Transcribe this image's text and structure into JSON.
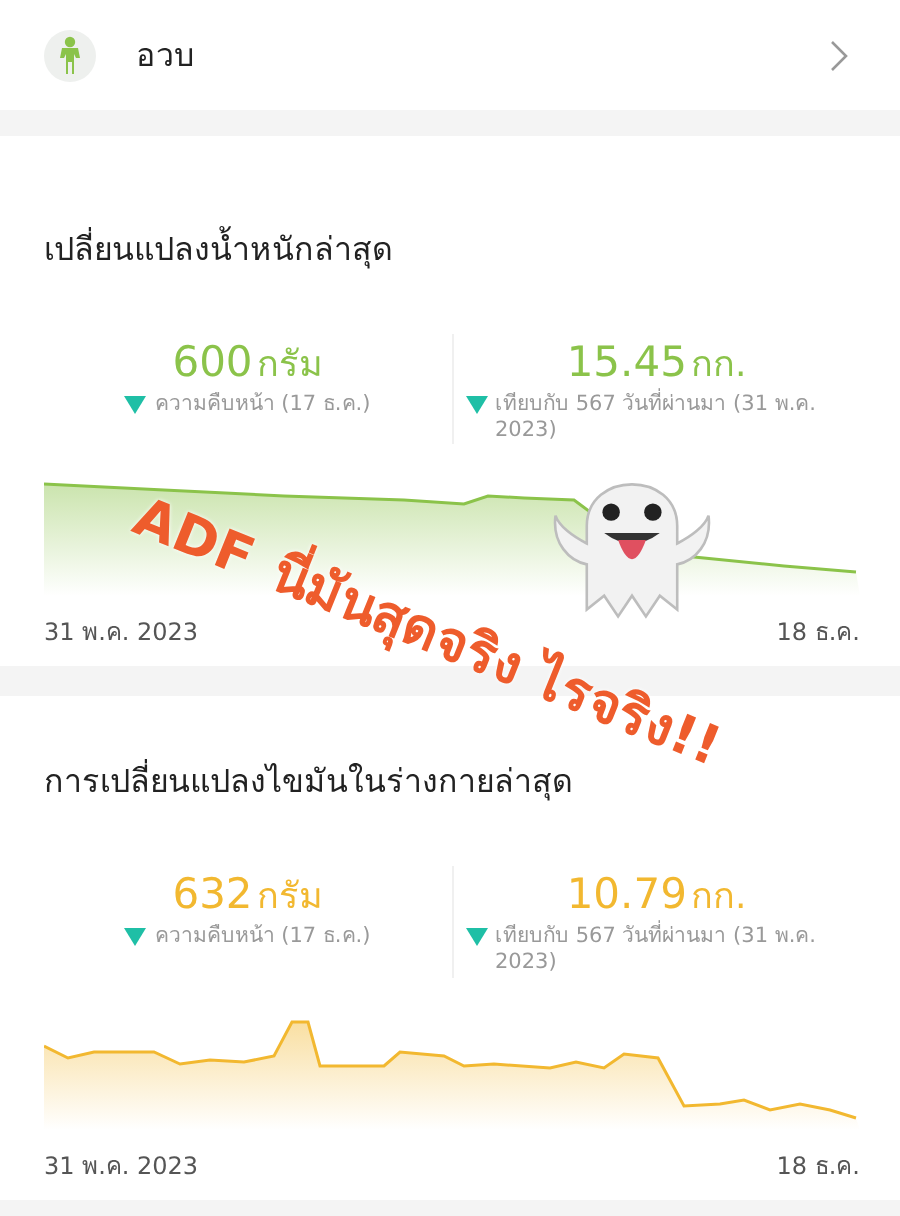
{
  "header": {
    "label": "อวบ"
  },
  "sections": [
    {
      "title": "เปลี่ยนแปลงน้ำหนักล่าสุด",
      "color": "#8bc34a",
      "stats": [
        {
          "value": "600",
          "unit": "กรัม",
          "note": "ความคืบหน้า (17 ธ.ค.)"
        },
        {
          "value": "15.45",
          "unit": "กก.",
          "note": "เทียบกับ 567 วันที่ผ่านมา (31 พ.ค. 2023)"
        }
      ],
      "start_label": "31 พ.ค. 2023",
      "end_label": "18 ธ.ค."
    },
    {
      "title": "การเปลี่ยนแปลงไขมันในร่างกายล่าสุด",
      "color": "#f2b830",
      "stats": [
        {
          "value": "632",
          "unit": "กรัม",
          "note": "ความคืบหน้า (17 ธ.ค.)"
        },
        {
          "value": "10.79",
          "unit": "กก.",
          "note": "เทียบกับ 567 วันที่ผ่านมา (31 พ.ค. 2023)"
        }
      ],
      "start_label": "31 พ.ค. 2023",
      "end_label": "18 ธ.ค."
    }
  ],
  "overlay": {
    "words": [
      "ADF",
      "นี่มันสุดจริง",
      "ไรจริง!!"
    ]
  }
}
